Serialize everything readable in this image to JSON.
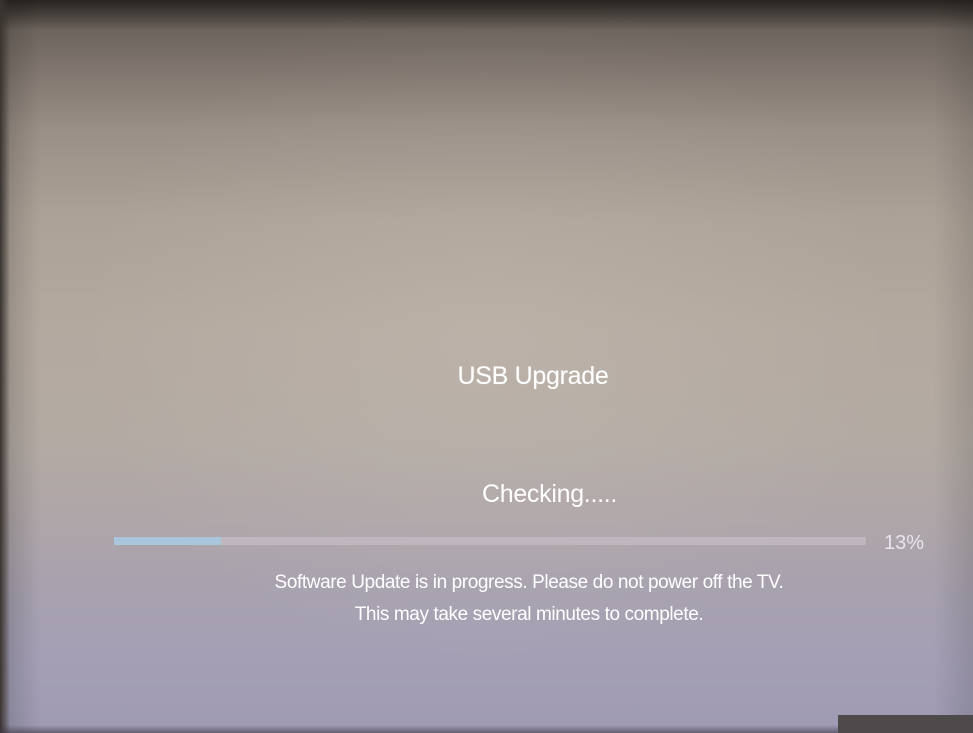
{
  "screen": {
    "title": "USB Upgrade",
    "status": "Checking.....",
    "progress": {
      "value": 13,
      "label": "13%"
    },
    "message": {
      "line1": "Software Update is in progress. Please do not power off the TV.",
      "line2": "This may take several minutes to complete."
    }
  },
  "colors": {
    "progress_fill": "#a9c6dc",
    "text": "#ffffff"
  }
}
